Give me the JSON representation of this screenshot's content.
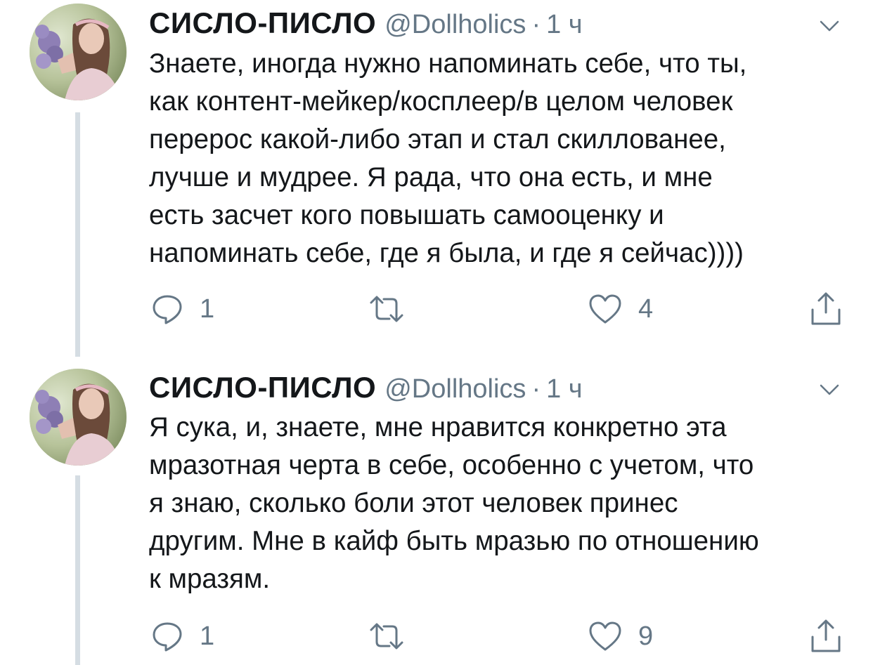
{
  "tweets": [
    {
      "author": {
        "display_name": "СИСЛО-ПИСЛО",
        "handle": "@Dollholics",
        "time": "1 ч"
      },
      "text_lines": [
        "Знаете, иногда нужно напоминать себе, что ты,",
        "как контент-мейкер/косплеер/в целом человек",
        "перерос какой-либо этап и стал скиллованее,",
        "лучше и мудрее. Я рада, что она есть, и мне",
        "есть засчет кого повышать самооценку и",
        "напоминать себе, где я была, и где я сейчас))))"
      ],
      "actions": {
        "replies": "1",
        "retweets": "",
        "likes": "4"
      }
    },
    {
      "author": {
        "display_name": "СИСЛО-ПИСЛО",
        "handle": "@Dollholics",
        "time": "1 ч"
      },
      "text_lines": [
        "Я сука, и, знаете, мне нравится конкретно эта",
        "мразотная черта в себе, особенно с учетом, что",
        "я знаю, сколько боли этот человек принес",
        "другим. Мне в кайф быть мразью по отношению",
        "к мразям."
      ],
      "actions": {
        "replies": "1",
        "retweets": "",
        "likes": "9"
      }
    }
  ],
  "separator": "·",
  "icons": {
    "reply": "reply-icon",
    "retweet": "retweet-icon",
    "like": "like-icon",
    "share": "share-icon",
    "menu": "chevron-down-icon"
  },
  "colors": {
    "text": "#14171a",
    "secondary": "#657786",
    "thread_line": "#d5dde3"
  }
}
